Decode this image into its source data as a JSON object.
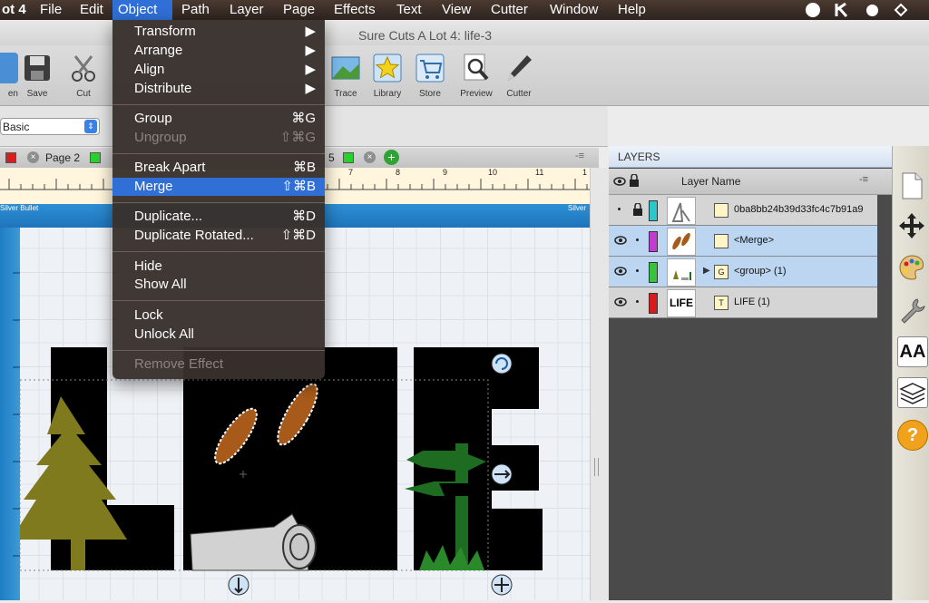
{
  "menubar": {
    "app_name_fragment": "ot 4",
    "items": [
      "File",
      "Edit",
      "Object",
      "Path",
      "Layer",
      "Page",
      "Effects",
      "Text",
      "View",
      "Cutter",
      "Window",
      "Help"
    ],
    "active": "Object"
  },
  "window": {
    "title": "Sure Cuts A Lot 4: life-3"
  },
  "toolbar": {
    "buttons": [
      {
        "label": "en",
        "icon": "open-icon"
      },
      {
        "label": "Save",
        "icon": "save-icon"
      },
      {
        "label": "Cut",
        "icon": "scissors-icon"
      },
      {
        "label": "Trace",
        "icon": "trace-icon"
      },
      {
        "label": "Library",
        "icon": "star-icon"
      },
      {
        "label": "Store",
        "icon": "cart-icon"
      },
      {
        "label": "Preview",
        "icon": "magnifier-icon"
      },
      {
        "label": "Cutter",
        "icon": "blade-icon"
      }
    ]
  },
  "style_select": {
    "value": "Basic"
  },
  "page_tabs": {
    "page2_label": "Page 2",
    "tab5_label": "5"
  },
  "ruler": {
    "ticks": [
      "7",
      "8",
      "9",
      "10",
      "11",
      "1"
    ],
    "strip_left": "Silver Bullet",
    "strip_right": "Silver"
  },
  "object_menu": {
    "items": [
      {
        "label": "Transform",
        "shortcut": "▶",
        "state": "normal"
      },
      {
        "label": "Arrange",
        "shortcut": "▶",
        "state": "normal"
      },
      {
        "label": "Align",
        "shortcut": "▶",
        "state": "normal"
      },
      {
        "label": "Distribute",
        "shortcut": "▶",
        "state": "normal"
      },
      {
        "label": "Group",
        "shortcut": "⌘G",
        "state": "normal"
      },
      {
        "label": "Ungroup",
        "shortcut": "⇧⌘G",
        "state": "disabled"
      },
      {
        "label": "Break Apart",
        "shortcut": "⌘B",
        "state": "normal"
      },
      {
        "label": "Merge",
        "shortcut": "⇧⌘B",
        "state": "highlighted"
      },
      {
        "label": "Duplicate...",
        "shortcut": "⌘D",
        "state": "normal"
      },
      {
        "label": "Duplicate Rotated...",
        "shortcut": "⇧⌘D",
        "state": "normal"
      },
      {
        "label": "Hide",
        "shortcut": "",
        "state": "normal"
      },
      {
        "label": "Show All",
        "shortcut": "",
        "state": "normal"
      },
      {
        "label": "Lock",
        "shortcut": "",
        "state": "normal"
      },
      {
        "label": "Unlock All",
        "shortcut": "",
        "state": "normal"
      },
      {
        "label": "Remove Effect",
        "shortcut": "",
        "state": "disabled"
      }
    ]
  },
  "layers_panel": {
    "title": "LAYERS",
    "column_header": "Layer Name",
    "rows": [
      {
        "name": "0ba8bb24b39d33fc4c7b91a9",
        "color": "#2ec6c9",
        "locked": true,
        "visible": false,
        "type": "image"
      },
      {
        "name": "<Merge>",
        "color": "#c13bd1",
        "locked": false,
        "visible": true,
        "type": "path"
      },
      {
        "name": "<group> (1)",
        "color": "#36c23c",
        "locked": false,
        "visible": true,
        "type": "group"
      },
      {
        "name": "LIFE (1)",
        "color": "#d51d1d",
        "locked": false,
        "visible": true,
        "type": "text"
      }
    ],
    "group_icon_letter": "G",
    "text_icon_letter": "T",
    "life_thumb_text": "LIFE"
  },
  "right_tools": [
    "page-icon",
    "move-arrows-icon",
    "palette-icon",
    "wrench-icon",
    "text-style-icon",
    "layers-icon",
    "help-icon"
  ],
  "help_symbol": "?",
  "text_tool_label": "AA",
  "colors": {
    "menu_highlight": "#2f6fd6",
    "letters": "#000000",
    "tree": "#7f7a1e",
    "sign": "#1e6b22",
    "boots": "#a85a1a"
  }
}
